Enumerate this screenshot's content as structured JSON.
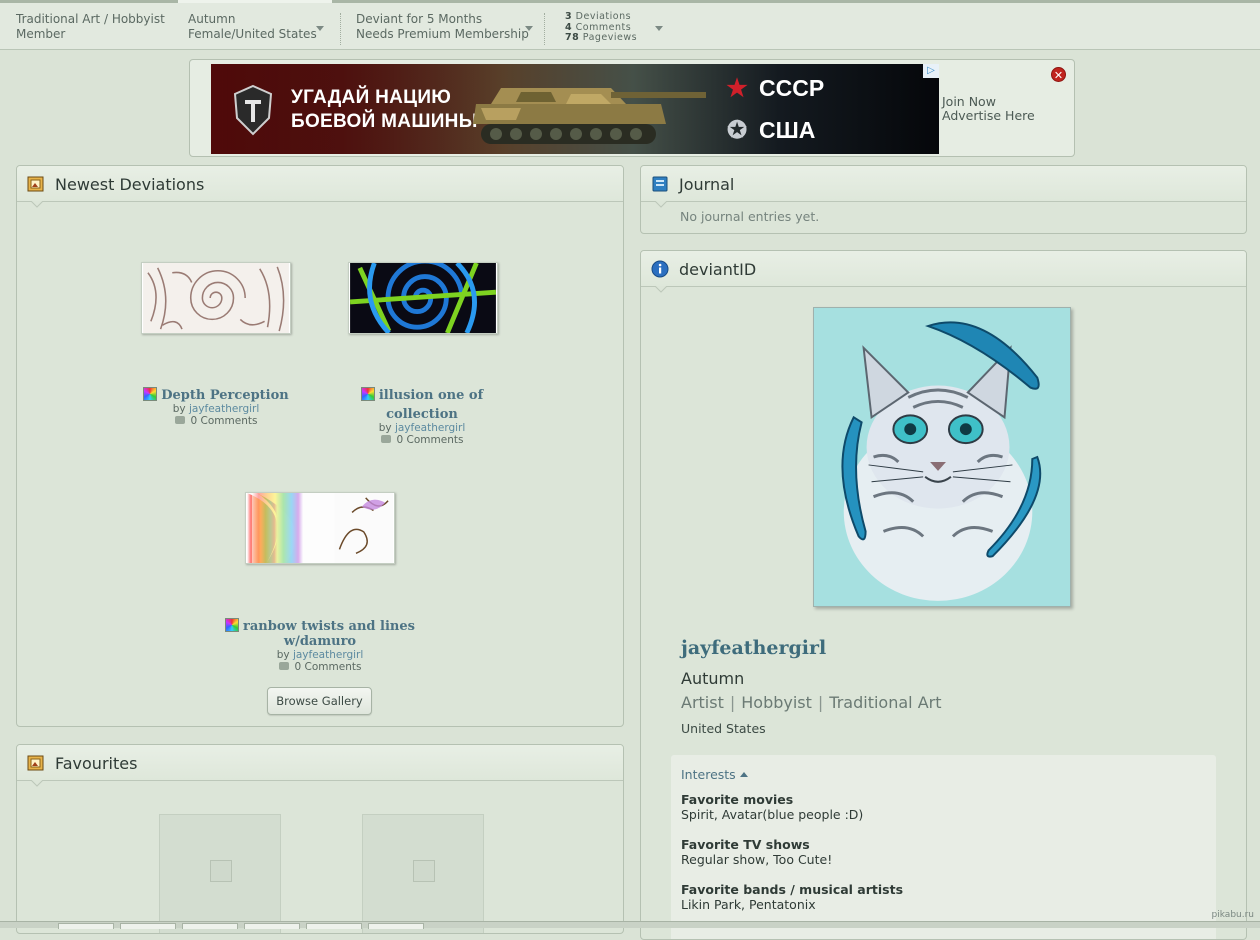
{
  "topbar": {
    "cell1_line1": "Traditional Art / Hobbyist",
    "cell1_line2": "Member",
    "cell2_line1": "Autumn",
    "cell2_line2": "Female/United States",
    "cell3_line1": "Deviant for 5 Months",
    "cell3_line2": "Needs Premium Membership",
    "deviations_count": "3",
    "deviations_label": "Deviations",
    "comments_count": "4",
    "comments_label": "Comments",
    "pageviews_count": "78",
    "pageviews_label": "Pageviews"
  },
  "ad": {
    "headline_line1": "УГАДАЙ НАЦИЮ",
    "headline_line2": "БОЕВОЙ МАШИНЫ",
    "option1": "СССР",
    "option2": "США",
    "choices_glyph": "▷",
    "join_now": "Join Now",
    "advertise": "Advertise Here",
    "close_glyph": "✕"
  },
  "newest": {
    "title": "Newest Deviations",
    "items": [
      {
        "title": "Depth Perception",
        "by": "by",
        "author": "jayfeathergirl",
        "comments": "0 Comments"
      },
      {
        "title": "illusion one of collection",
        "by": "by",
        "author": "jayfeathergirl",
        "comments": "0 Comments"
      },
      {
        "title_line1": "ranbow twists and lines",
        "title_line2": "w/damuro",
        "by": "by",
        "author": "jayfeathergirl",
        "comments": "0 Comments"
      }
    ],
    "browse_button": "Browse Gallery"
  },
  "favourites": {
    "title": "Favourites"
  },
  "journal": {
    "title": "Journal",
    "empty_text": "No journal entries yet."
  },
  "deviantid": {
    "title": "deviantID",
    "username": "jayfeathergirl",
    "real_name": "Autumn",
    "tags": [
      "Artist",
      "Hobbyist",
      "Traditional Art"
    ],
    "tag_separator": "|",
    "country": "United States",
    "interests_label": "Interests",
    "interests": [
      {
        "label": "Favorite movies",
        "value": "Spirit, Avatar(blue people :D)"
      },
      {
        "label": "Favorite TV shows",
        "value": "Regular show, Too Cute!"
      },
      {
        "label": "Favorite bands / musical artists",
        "value": "Likin Park, Pentatonix"
      }
    ]
  },
  "watermark": "pikabu.ru",
  "colors": {
    "background": "#dae3d6",
    "link": "#4d7384",
    "panel_border": "#b5c1b2"
  }
}
